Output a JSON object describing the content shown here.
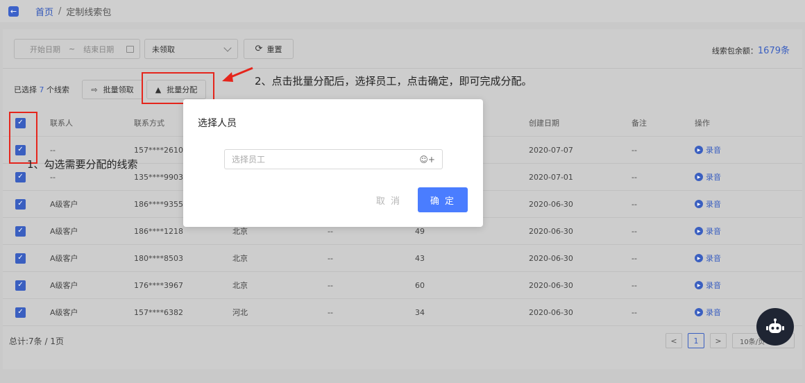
{
  "breadcrumb": {
    "home": "首页",
    "separator": "/",
    "current": "定制线索包"
  },
  "filters": {
    "start_placeholder": "开始日期",
    "range_separator": "~",
    "end_placeholder": "结束日期",
    "status_value": "未领取",
    "reset_label": "重置"
  },
  "balance": {
    "label": "线索包余额：",
    "value": "1679条"
  },
  "actions": {
    "selected_prefix": "已选择",
    "selected_count": "7",
    "selected_suffix": "个线索",
    "claim_label": "批量领取",
    "assign_label": "批量分配"
  },
  "table": {
    "headers": {
      "contact": "联系人",
      "phone": "联系方式",
      "date": "创建日期",
      "note": "备注",
      "op": "操作"
    },
    "rows": [
      {
        "name": "--",
        "phone": "157****2610",
        "area": "",
        "d1": "",
        "d2": "",
        "date": "2020-07-07",
        "note": "--",
        "op": "录音"
      },
      {
        "name": "--",
        "phone": "135****9903",
        "area": "",
        "d1": "",
        "d2": "",
        "date": "2020-07-01",
        "note": "--",
        "op": "录音"
      },
      {
        "name": "A级客户",
        "phone": "186****9355",
        "area": "",
        "d1": "",
        "d2": "",
        "date": "2020-06-30",
        "note": "--",
        "op": "录音"
      },
      {
        "name": "A级客户",
        "phone": "186****1218",
        "area": "北京",
        "d1": "--",
        "d2": "49",
        "date": "2020-06-30",
        "note": "--",
        "op": "录音"
      },
      {
        "name": "A级客户",
        "phone": "180****8503",
        "area": "北京",
        "d1": "--",
        "d2": "43",
        "date": "2020-06-30",
        "note": "--",
        "op": "录音"
      },
      {
        "name": "A级客户",
        "phone": "176****3967",
        "area": "北京",
        "d1": "--",
        "d2": "60",
        "date": "2020-06-30",
        "note": "--",
        "op": "录音"
      },
      {
        "name": "A级客户",
        "phone": "157****6382",
        "area": "河北",
        "d1": "--",
        "d2": "34",
        "date": "2020-06-30",
        "note": "--",
        "op": "录音"
      }
    ]
  },
  "footer": {
    "total": "总计:7条 / 1页",
    "prev": "<",
    "page": "1",
    "next": ">",
    "page_size": "10条/页"
  },
  "annotations": {
    "step1": "1、勾选需要分配的线索",
    "step2": "2、点击批量分配后，选择员工，点击确定，即可完成分配。"
  },
  "modal": {
    "title": "选择人员",
    "input_placeholder": "选择员工",
    "cancel_label": "取 消",
    "ok_label": "确 定"
  },
  "colors": {
    "accent": "#3a5fc0",
    "primary_button": "#4a7dff",
    "annotation": "#e5251c"
  }
}
